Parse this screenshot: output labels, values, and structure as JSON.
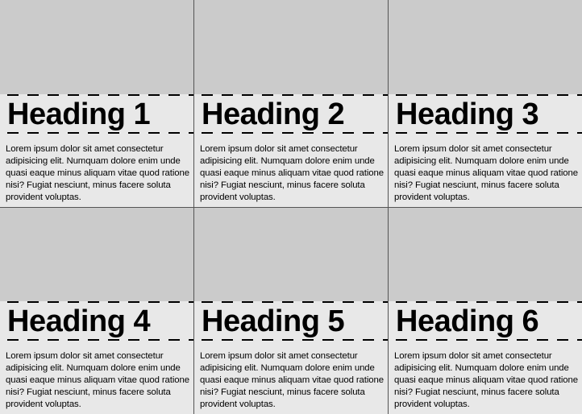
{
  "cards": [
    {
      "heading": "Heading 1",
      "text": "Lorem ipsum dolor sit amet consectetur adipisicing elit. Numquam dolore enim unde quasi eaque minus aliquam vitae quod ratione nisi? Fugiat nesciunt, minus facere soluta provident voluptas."
    },
    {
      "heading": "Heading 2",
      "text": "Lorem ipsum dolor sit amet consectetur adipisicing elit. Numquam dolore enim unde quasi eaque minus aliquam vitae quod ratione nisi? Fugiat nesciunt, minus facere soluta provident voluptas."
    },
    {
      "heading": "Heading 3",
      "text": "Lorem ipsum dolor sit amet consectetur adipisicing elit. Numquam dolore enim unde quasi eaque minus aliquam vitae quod ratione nisi? Fugiat nesciunt, minus facere soluta provident voluptas."
    },
    {
      "heading": "Heading 4",
      "text": "Lorem ipsum dolor sit amet consectetur adipisicing elit. Numquam dolore enim unde quasi eaque minus aliquam vitae quod ratione nisi? Fugiat nesciunt, minus facere soluta provident voluptas."
    },
    {
      "heading": "Heading 5",
      "text": "Lorem ipsum dolor sit amet consectetur adipisicing elit. Numquam dolore enim unde quasi eaque minus aliquam vitae quod ratione nisi? Fugiat nesciunt, minus facere soluta provident voluptas."
    },
    {
      "heading": "Heading 6",
      "text": "Lorem ipsum dolor sit amet consectetur adipisicing elit. Numquam dolore enim unde quasi eaque minus aliquam vitae quod ratione nisi? Fugiat nesciunt, minus facere soluta provident voluptas."
    }
  ],
  "colors": {
    "image_placeholder": "#cbcbcb",
    "band_background": "#e8e8e8",
    "divider": "#555555",
    "dash": "#000000"
  }
}
